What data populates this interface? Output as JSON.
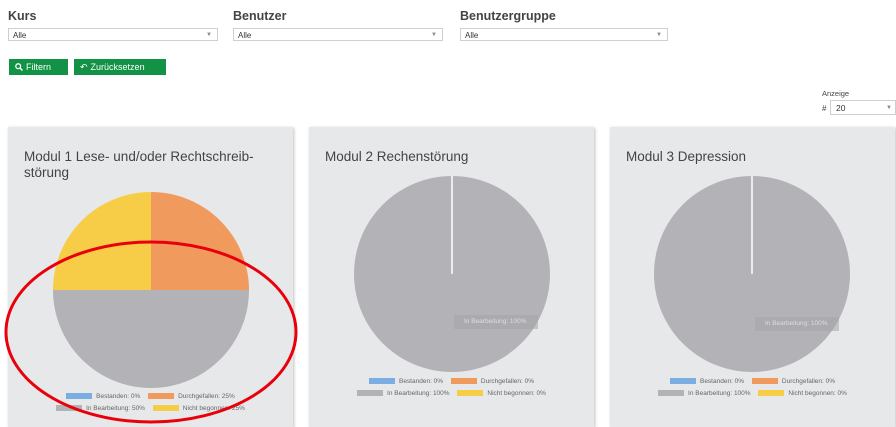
{
  "filters": {
    "kurs": {
      "label": "Kurs",
      "value": "Alle"
    },
    "benutzer": {
      "label": "Benutzer",
      "value": "Alle"
    },
    "benutzergruppe": {
      "label": "Benutzergruppe",
      "value": "Alle"
    }
  },
  "buttons": {
    "filter": "Filtern",
    "reset": "Zurücksetzen"
  },
  "anzeige": {
    "label": "Anzeige",
    "hash": "#",
    "value": "20"
  },
  "colors": {
    "bestanden": "#7aaee0",
    "durchgefallen": "#f09a5e",
    "in_bearbeitung": "#b3b2b7",
    "nicht_begonnen": "#f7cc47",
    "button": "#129245",
    "annotation": "#e8000b"
  },
  "cards": [
    {
      "title": "Modul 1 Lese- und/oder Rechtschreib-störung",
      "chart_data": {
        "type": "pie",
        "categories": [
          "Bestanden",
          "Durchgefallen",
          "In Bearbeitung",
          "Nicht begonnen"
        ],
        "values": [
          0,
          25,
          50,
          25
        ]
      },
      "legend": [
        "Bestanden: 0%",
        "Durchgefallen: 25%",
        "In Bearbeitung: 50%",
        "Nicht begonnen: 25%"
      ],
      "tooltip": ""
    },
    {
      "title": "Modul 2 Rechenstörung",
      "chart_data": {
        "type": "pie",
        "categories": [
          "Bestanden",
          "Durchgefallen",
          "In Bearbeitung",
          "Nicht begonnen"
        ],
        "values": [
          0,
          0,
          100,
          0
        ]
      },
      "legend": [
        "Bestanden: 0%",
        "Durchgefallen: 0%",
        "In Bearbeitung: 100%",
        "Nicht begonnen: 0%"
      ],
      "tooltip": "In Bearbeitung: 100%"
    },
    {
      "title": "Modul 3 Depression",
      "chart_data": {
        "type": "pie",
        "categories": [
          "Bestanden",
          "Durchgefallen",
          "In Bearbeitung",
          "Nicht begonnen"
        ],
        "values": [
          0,
          0,
          100,
          0
        ]
      },
      "legend": [
        "Bestanden: 0%",
        "Durchgefallen: 0%",
        "In Bearbeitung: 100%",
        "Nicht begonnen: 0%"
      ],
      "tooltip": "In Bearbeitung: 100%"
    }
  ]
}
